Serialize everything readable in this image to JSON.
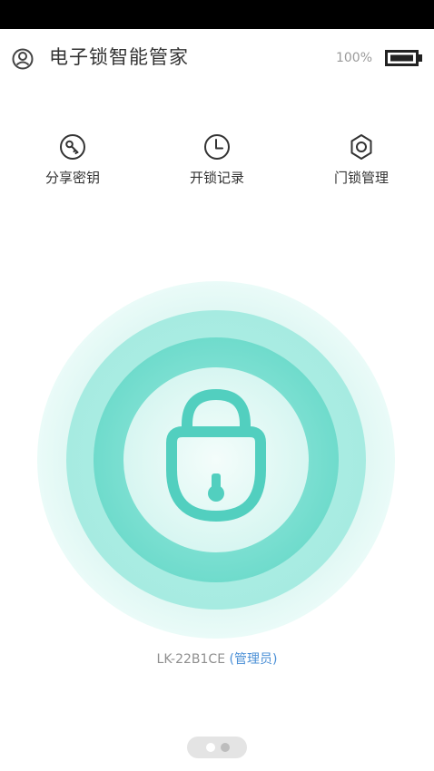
{
  "header": {
    "title": "电子锁智能管家",
    "battery_level": "100%"
  },
  "actions": [
    {
      "label": "分享密钥",
      "icon": "key-icon"
    },
    {
      "label": "开锁记录",
      "icon": "clock-icon"
    },
    {
      "label": "门锁管理",
      "icon": "gear-icon"
    }
  ],
  "lock": {
    "icon": "padlock-icon",
    "state": "locked"
  },
  "device": {
    "id": "LK-22B1CE",
    "role": "(管理员)"
  },
  "pager": {
    "pages": 2,
    "active": 1
  },
  "colors": {
    "accent": "#5ed6c6",
    "accent_dark": "#4fcdbd",
    "link": "#4a8fd6",
    "battery_fill": "#222222"
  }
}
